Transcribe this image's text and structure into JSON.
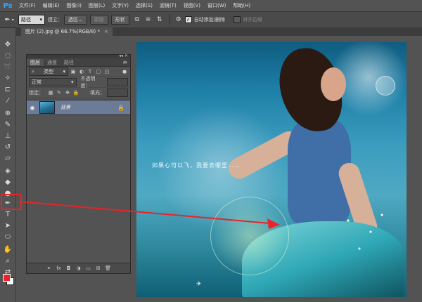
{
  "app": {
    "logo": "Ps"
  },
  "menu": [
    "文件(F)",
    "编辑(E)",
    "图像(I)",
    "图层(L)",
    "文字(Y)",
    "选择(S)",
    "滤镜(T)",
    "视图(V)",
    "窗口(W)",
    "帮助(H)"
  ],
  "options": {
    "mode_value": "路径",
    "build_label": "建立：",
    "selection_btn": "选区...",
    "mask_btn": "蒙版",
    "shape_btn": "形状",
    "auto_add_delete": "自动添加/删除",
    "align_edges": "对齐边缘"
  },
  "document": {
    "tab_title": "图片 (2).jpg @ 66.7%(RGB/8) *",
    "close": "×"
  },
  "layers_panel": {
    "tabs": [
      "图层",
      "通道",
      "路径"
    ],
    "kind_filter": "类型",
    "blend_mode": "正常",
    "opacity_label": "不透明度：",
    "lock_label": "锁定：",
    "fill_label": "填充：",
    "layer_name": "背景"
  },
  "canvas": {
    "caption": "如果心可以飞，我要去哪里……"
  },
  "colors": {
    "foreground": "#e8232a",
    "background": "#ffffff",
    "highlight": "#e8232a",
    "arrow": "#e8232a"
  },
  "icons": {
    "active_tool": "pen-icon"
  }
}
